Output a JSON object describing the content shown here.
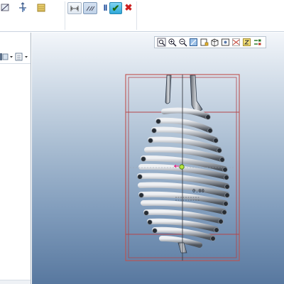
{
  "ribbon": {
    "icons": [
      "ribbon-tool-icon",
      "datum-axis-icon",
      "layers-icon"
    ],
    "sketch_tools": [
      "dimension-icon",
      "dimension-pattern-icon"
    ],
    "pause_label": "II",
    "accept_label": "✔",
    "cancel_label": "✖"
  },
  "model_tree": {
    "toolbar_icons": [
      "tree-settings-icon",
      "tree-columns-icon"
    ]
  },
  "viewport": {
    "dimension_label": "0.00",
    "view_toolbar_icons": [
      "zoom-fit-icon",
      "zoom-in-icon",
      "zoom-out-icon",
      "repaint-icon",
      "shading-icon",
      "saved-views-icon",
      "view-manager-icon",
      "datum-display-icon",
      "spin-center-icon",
      "annotation-display-icon"
    ]
  },
  "colors": {
    "accept": "#2a8a1a",
    "cancel": "#cc1f1f",
    "frame": "#c0504d",
    "spring": "#8d9299"
  }
}
